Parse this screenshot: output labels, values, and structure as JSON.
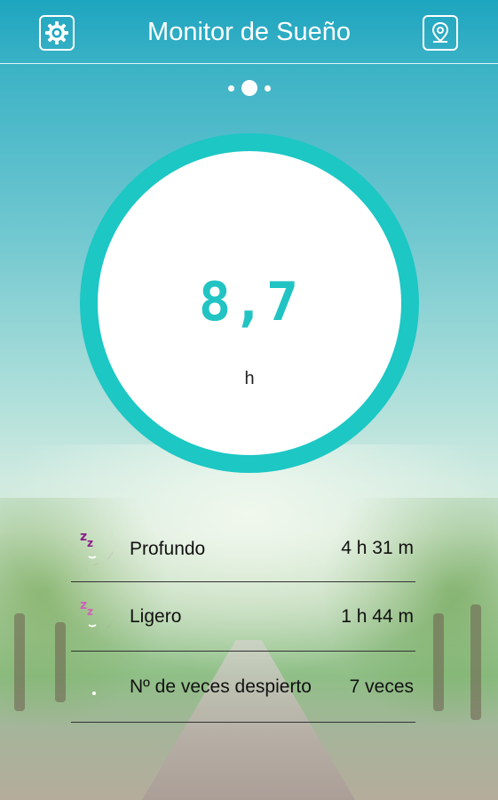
{
  "header": {
    "title": "Monitor de Sueño",
    "left_icon": "settings-gear-icon",
    "right_icon": "location-pin-icon"
  },
  "pager": {
    "count": 3,
    "active_index": 1
  },
  "gauge": {
    "value": "8,7",
    "unit": "h",
    "ring_color": "#1cc7c4",
    "value_color": "#22c3c3"
  },
  "stats": [
    {
      "icon": "deep-sleep-moon-icon",
      "icon_color": "#8a1d8a",
      "label": "Profundo",
      "value": "4 h 31 m"
    },
    {
      "icon": "light-sleep-moon-icon",
      "icon_color": "#d35fb7",
      "label": "Ligero",
      "value": "1 h 44 m"
    },
    {
      "icon": "awake-moon-icon",
      "icon_color": "#8f86d6",
      "label": "Nº de veces despierto",
      "value": "7 veces"
    }
  ]
}
